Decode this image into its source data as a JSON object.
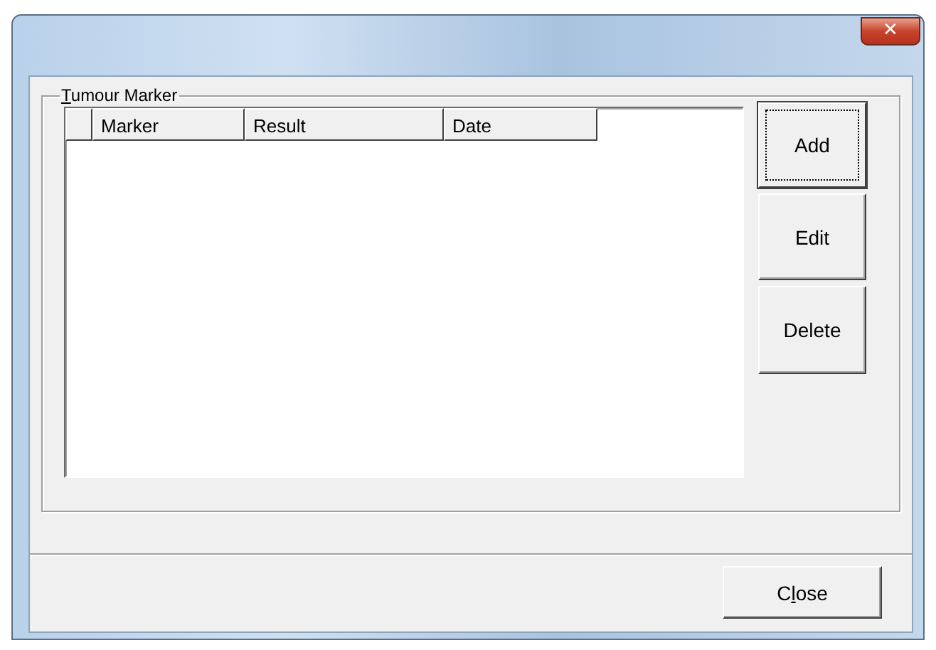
{
  "window": {
    "close_glyph": "✕"
  },
  "group": {
    "label_parts": [
      {
        "text": "T",
        "underlined": true
      },
      {
        "text": "umour Marker",
        "underlined": false
      }
    ]
  },
  "table": {
    "columns": [
      "",
      "Marker",
      "Result",
      "Date"
    ]
  },
  "side_buttons": [
    {
      "label": "Add",
      "focused": true
    },
    {
      "label": "Edit",
      "focused": false
    },
    {
      "label": "Delete",
      "focused": false
    }
  ],
  "close_button": {
    "label_parts": [
      {
        "text": "C",
        "underlined": false
      },
      {
        "text": "l",
        "underlined": true
      },
      {
        "text": "ose",
        "underlined": false
      }
    ]
  }
}
